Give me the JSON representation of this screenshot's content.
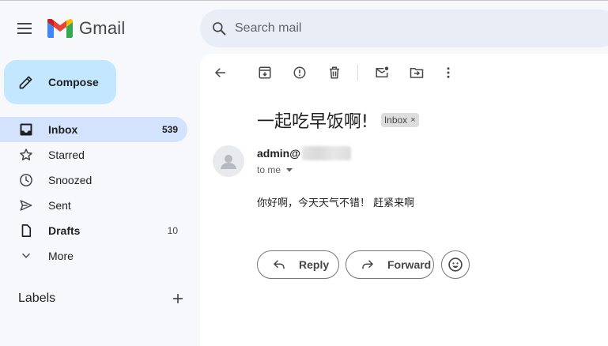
{
  "header": {
    "app_name": "Gmail",
    "search_placeholder": "Search mail"
  },
  "compose": {
    "label": "Compose"
  },
  "nav": {
    "items": [
      {
        "label": "Inbox",
        "count": "539",
        "icon": "inbox-icon"
      },
      {
        "label": "Starred",
        "count": "",
        "icon": "star-icon"
      },
      {
        "label": "Snoozed",
        "count": "",
        "icon": "clock-icon"
      },
      {
        "label": "Sent",
        "count": "",
        "icon": "send-icon"
      },
      {
        "label": "Drafts",
        "count": "10",
        "icon": "draft-icon"
      },
      {
        "label": "More",
        "count": "",
        "icon": "chevron-down-icon"
      }
    ],
    "labels_title": "Labels"
  },
  "message": {
    "subject": "一起吃早饭啊!",
    "label_chip": "Inbox",
    "chip_close": "×",
    "sender_visible": "admin@",
    "recipient_line": "to me",
    "body": "你好啊，今天天气不错！ 赶紧来啊",
    "reply_label": "Reply",
    "forward_label": "Forward"
  },
  "colors": {
    "background": "#f6f8fc",
    "compose_bg": "#c2e7ff",
    "active_nav_bg": "#d3e3fd",
    "search_bg": "#e9eef6",
    "gmail_red": "#ea4335",
    "gmail_blue": "#4285f4",
    "gmail_green": "#34a853",
    "gmail_yellow": "#fbbc04"
  }
}
